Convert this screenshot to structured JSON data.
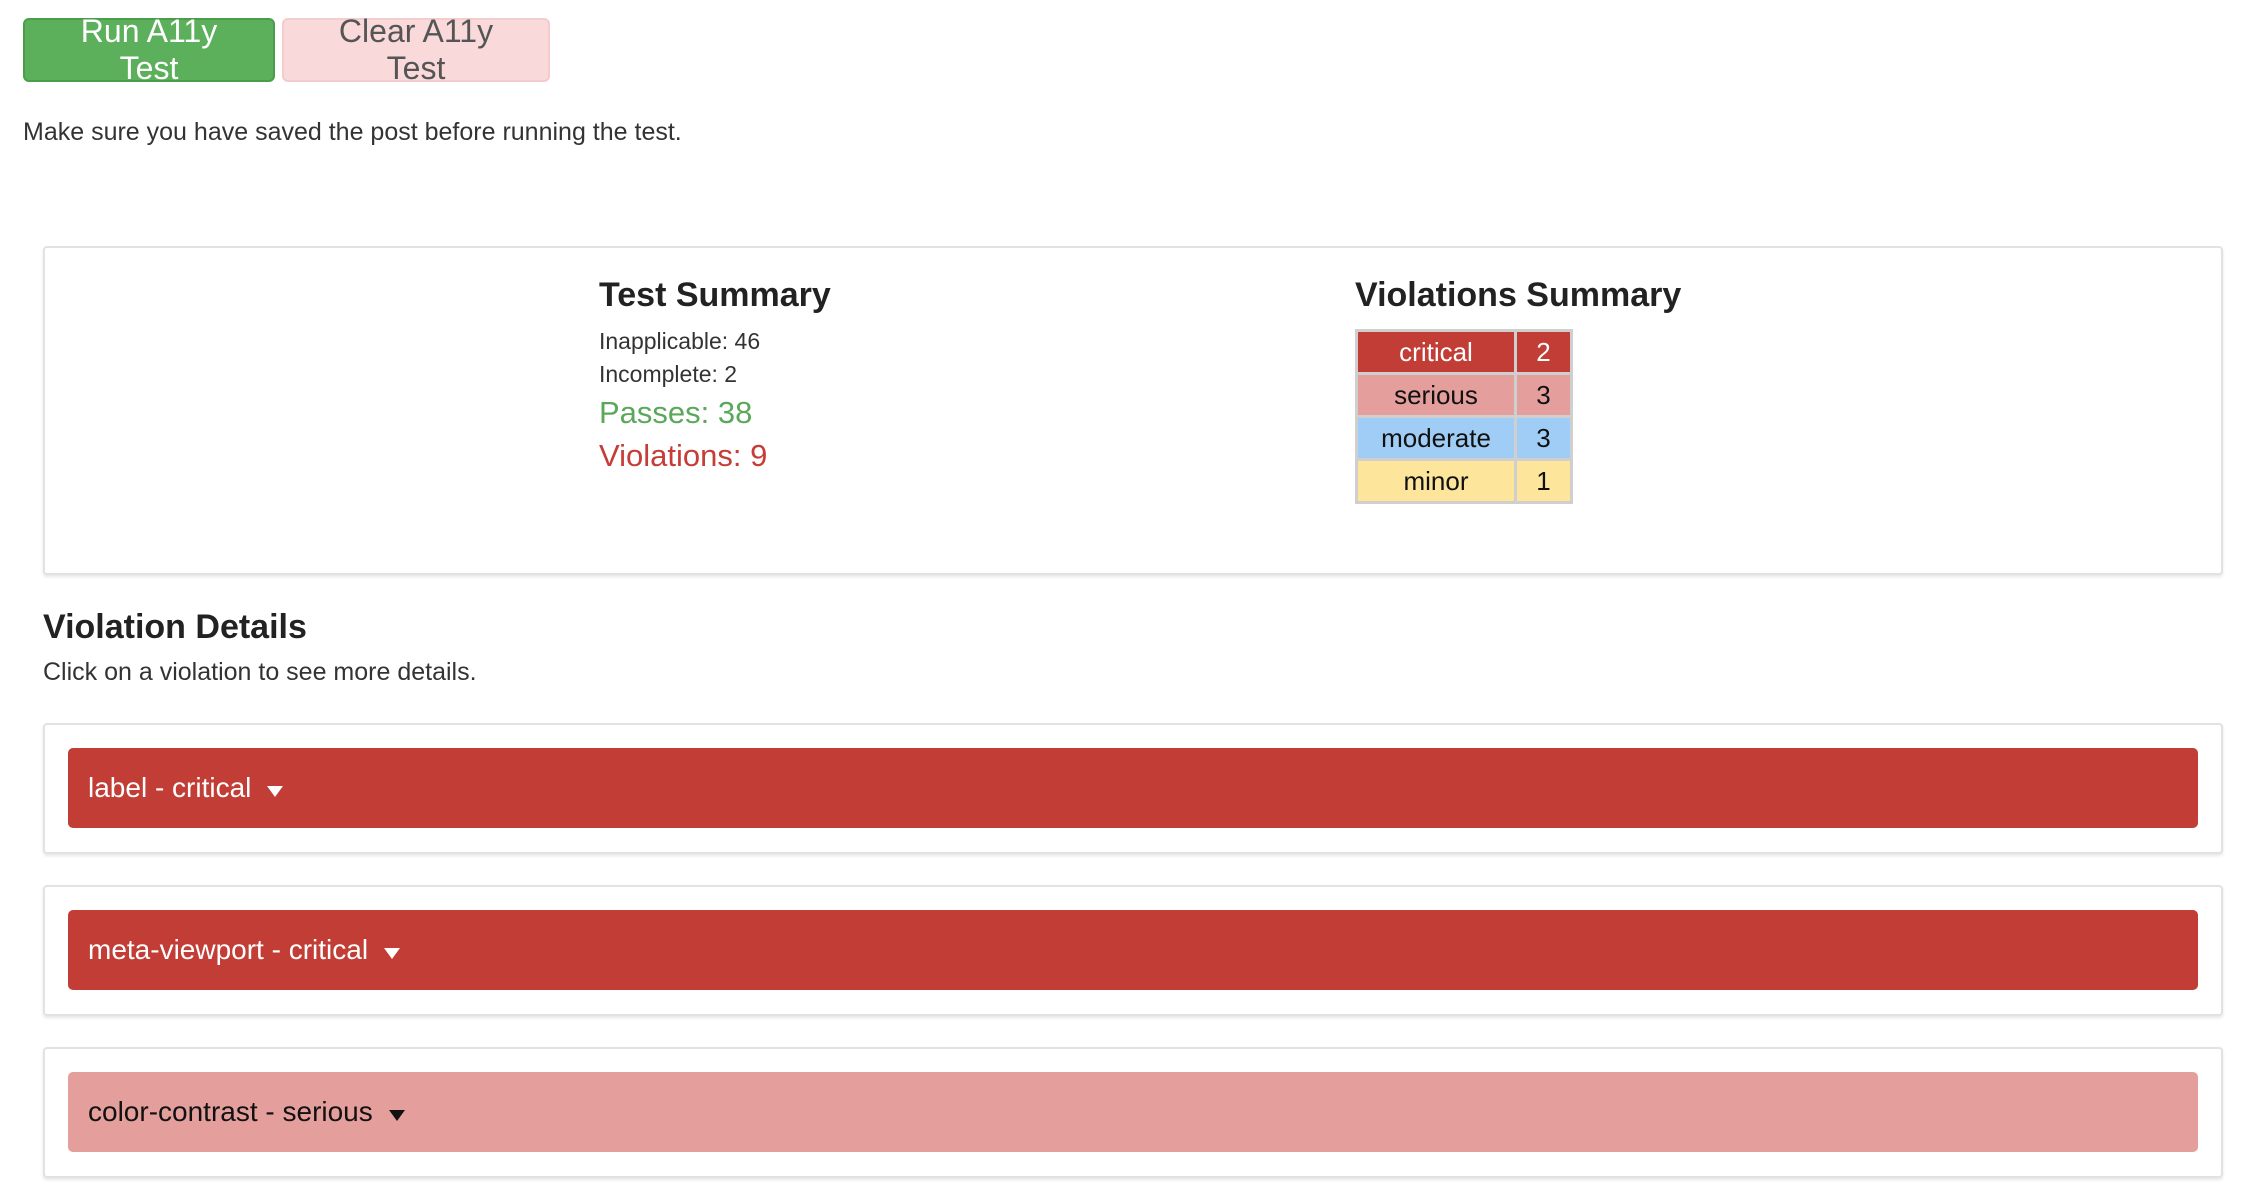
{
  "toolbar": {
    "run_label": "Run A11y Test",
    "clear_label": "Clear A11y Test"
  },
  "notice": "Make sure you have saved the post before running the test.",
  "test_summary": {
    "title": "Test Summary",
    "inapplicable": "Inapplicable: 46",
    "incomplete": "Incomplete: 2",
    "passes": "Passes: 38",
    "violations": "Violations: 9"
  },
  "violations_summary": {
    "title": "Violations Summary",
    "rows": [
      {
        "label": "critical",
        "count": "2",
        "color": "#c23d36"
      },
      {
        "label": "serious",
        "count": "3",
        "color": "#e49e9c"
      },
      {
        "label": "moderate",
        "count": "3",
        "color": "#9fcdf5"
      },
      {
        "label": "minor",
        "count": "1",
        "color": "#fde59b"
      }
    ]
  },
  "violation_details": {
    "title": "Violation Details",
    "hint": "Click on a violation to see more details.",
    "items": [
      {
        "label": "label - critical",
        "severity": "critical",
        "icon": "chevron-down-icon"
      },
      {
        "label": "meta-viewport - critical",
        "severity": "critical",
        "icon": "chevron-down-icon"
      },
      {
        "label": "color-contrast - serious",
        "severity": "serious",
        "icon": "chevron-down-icon"
      }
    ]
  },
  "colors": {
    "run_button": "#5cb05c",
    "clear_button": "#f9d9d9",
    "passes_text": "#5ba85b",
    "violations_text": "#c53d36"
  }
}
